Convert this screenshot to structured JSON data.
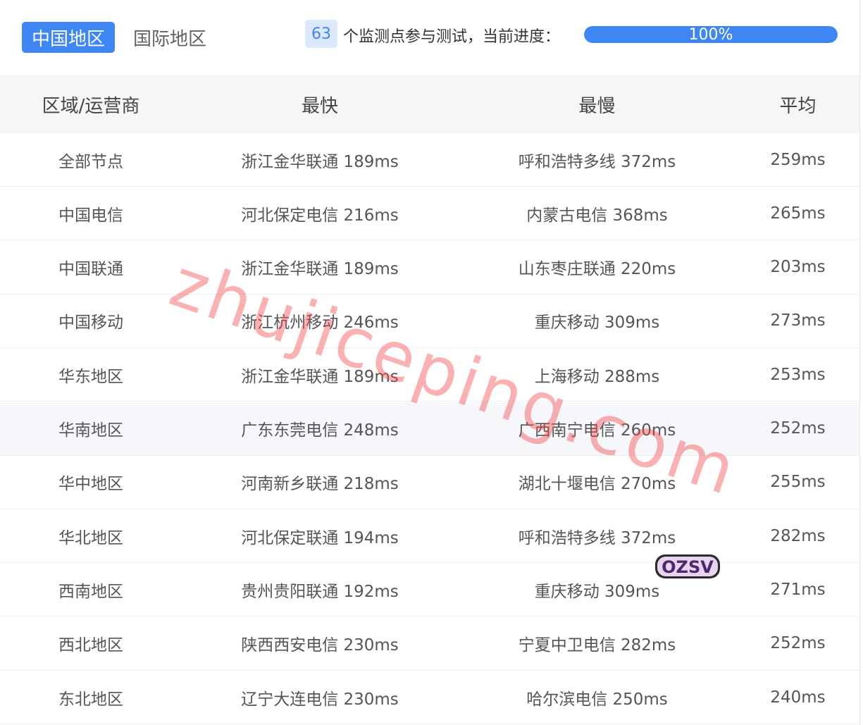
{
  "tabs": [
    {
      "label": "中国地区",
      "active": true
    },
    {
      "label": "国际地区",
      "active": false
    }
  ],
  "monitor": {
    "count": "63",
    "text": "个监测点参与测试，当前进度：",
    "progress_label": "100%",
    "progress": 1.0
  },
  "table": {
    "headers": [
      "区域/运营商",
      "最快",
      "最慢",
      "平均"
    ],
    "rows": [
      [
        "全部节点",
        "浙江金华联通 189ms",
        "呼和浩特多线 372ms",
        "259ms"
      ],
      [
        "中国电信",
        "河北保定电信 216ms",
        "内蒙古电信 368ms",
        "265ms"
      ],
      [
        "中国联通",
        "浙江金华联通 189ms",
        "山东枣庄联通 220ms",
        "203ms"
      ],
      [
        "中国移动",
        "浙江杭州移动 246ms",
        "重庆移动 309ms",
        "273ms"
      ],
      [
        "华东地区",
        "浙江金华联通 189ms",
        "上海移动 288ms",
        "253ms"
      ],
      [
        "华南地区",
        "广东东莞电信 248ms",
        "广西南宁电信 260ms",
        "252ms"
      ],
      [
        "华中地区",
        "河南新乡联通 218ms",
        "湖北十堰电信 270ms",
        "255ms"
      ],
      [
        "华北地区",
        "河北保定联通 194ms",
        "呼和浩特多线 372ms",
        "282ms"
      ],
      [
        "西南地区",
        "贵州贵阳联通 192ms",
        "重庆移动 309ms",
        "271ms"
      ],
      [
        "西北地区",
        "陕西西安电信 230ms",
        "宁夏中卫电信 282ms",
        "252ms"
      ],
      [
        "东北地区",
        "辽宁大连电信 230ms",
        "哈尔滨电信 250ms",
        "240ms"
      ]
    ],
    "highlighted_row": 5
  },
  "watermark": "zhujiceping.com",
  "sticker": "OZSV",
  "colors": {
    "accent": "#3f86f5",
    "badge_bg": "#dce9fc",
    "header_bg": "#f5f6f8",
    "watermark": "#f54646"
  }
}
